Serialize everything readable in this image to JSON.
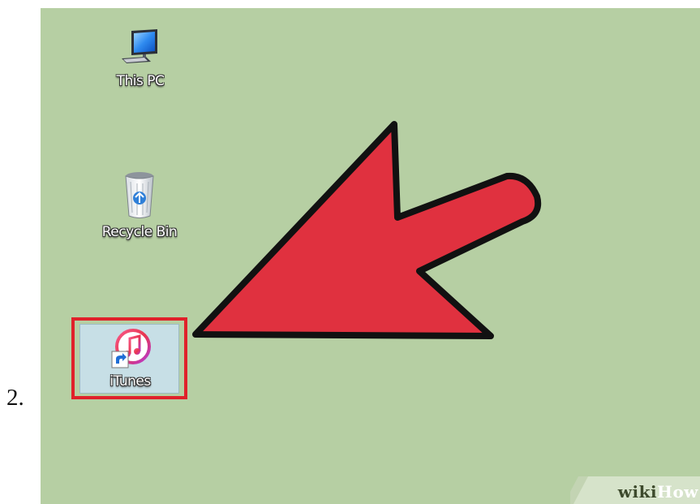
{
  "step": {
    "number": "2."
  },
  "desktop": {
    "background_color": "#b6cfa3",
    "icons": [
      {
        "label": "This PC",
        "icon": "computer-monitor-icon"
      },
      {
        "label": "Recycle Bin",
        "icon": "recycle-bin-icon"
      },
      {
        "label": "iTunes",
        "icon": "itunes-icon",
        "selected": true,
        "highlight_color": "#e0212a"
      }
    ]
  },
  "annotation": {
    "arrow_color": "#e0313f",
    "arrow_outline": "#111111"
  },
  "watermark": {
    "part1": "wiki",
    "part2": "How"
  }
}
